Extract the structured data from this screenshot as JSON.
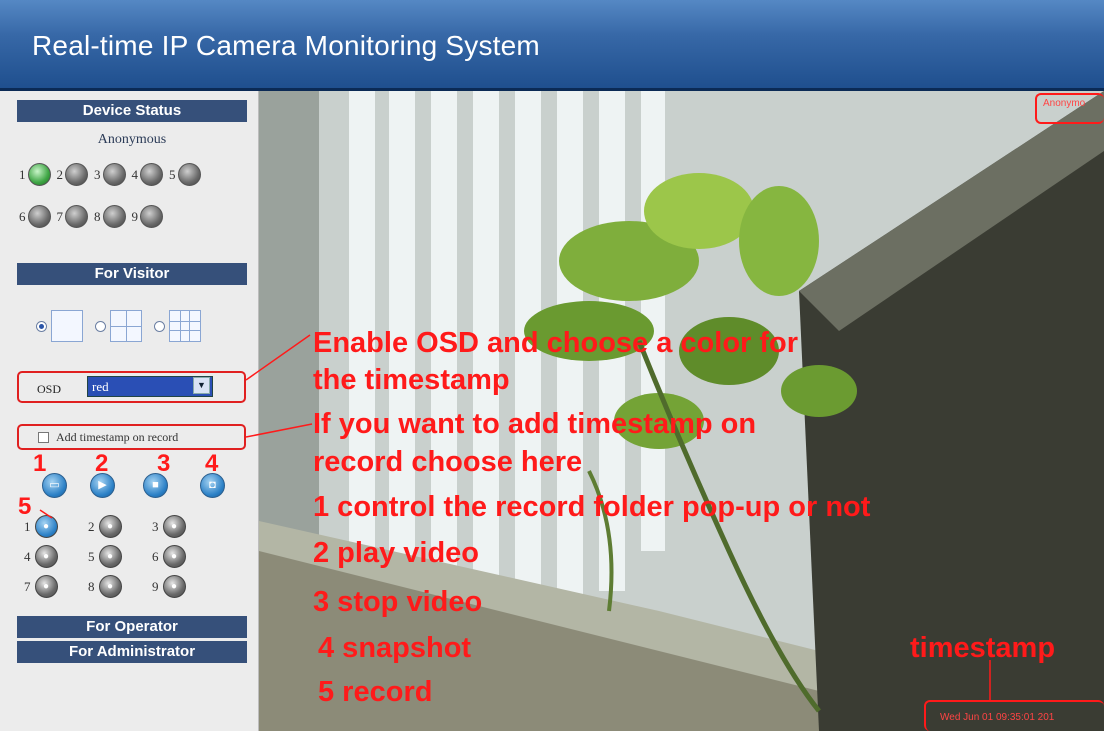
{
  "header": {
    "title": "Real-time IP Camera Monitoring System"
  },
  "sidebar": {
    "device_status": {
      "title": "Device Status",
      "user": "Anonymous",
      "devices": [
        {
          "label": "1",
          "state": "online"
        },
        {
          "label": "2",
          "state": "offline"
        },
        {
          "label": "3",
          "state": "offline"
        },
        {
          "label": "4",
          "state": "offline"
        },
        {
          "label": "5",
          "state": "offline"
        },
        {
          "label": "6",
          "state": "offline"
        },
        {
          "label": "7",
          "state": "offline"
        },
        {
          "label": "8",
          "state": "offline"
        },
        {
          "label": "9",
          "state": "offline"
        }
      ]
    },
    "for_visitor": {
      "title": "For Visitor",
      "layouts": [
        "single",
        "quad",
        "nine"
      ],
      "selected_layout": "single",
      "osd": {
        "label": "OSD",
        "value": "red"
      },
      "timestamp": {
        "label": "Add timestamp on record",
        "checked": false
      },
      "controls": [
        {
          "name": "record-folder",
          "icon": "folder-icon"
        },
        {
          "name": "play",
          "icon": "play-icon"
        },
        {
          "name": "stop",
          "icon": "stop-icon"
        },
        {
          "name": "snapshot",
          "icon": "camera-icon"
        }
      ],
      "record_channels": [
        "1",
        "2",
        "3",
        "4",
        "5",
        "6",
        "7",
        "8",
        "9"
      ],
      "recording_channel": "1"
    },
    "for_operator": {
      "title": "For Operator"
    },
    "for_administrator": {
      "title": "For Administrator"
    }
  },
  "video": {
    "overlay_user": "Anonymo",
    "overlay_timestamp": "Wed Jun 01 09:35:01 201"
  },
  "annotations": {
    "osd_line1": "Enable OSD and choose a color for",
    "osd_line2": "the timestamp",
    "ts_line1": "If you want to add timestamp on",
    "ts_line2": "record choose here",
    "item1": "1 control the record folder pop-up or not",
    "item2": "2 play video",
    "item3": "3 stop video",
    "item4": "4 snapshot",
    "item5": "5 record",
    "timestamp_label": "timestamp",
    "num1": "1",
    "num2": "2",
    "num3": "3",
    "num4": "4",
    "num5": "5"
  },
  "colors": {
    "header": "#2a5a9c",
    "section_bar": "#36507a",
    "annotation": "#ff1a1a",
    "online": "#3ea544"
  }
}
